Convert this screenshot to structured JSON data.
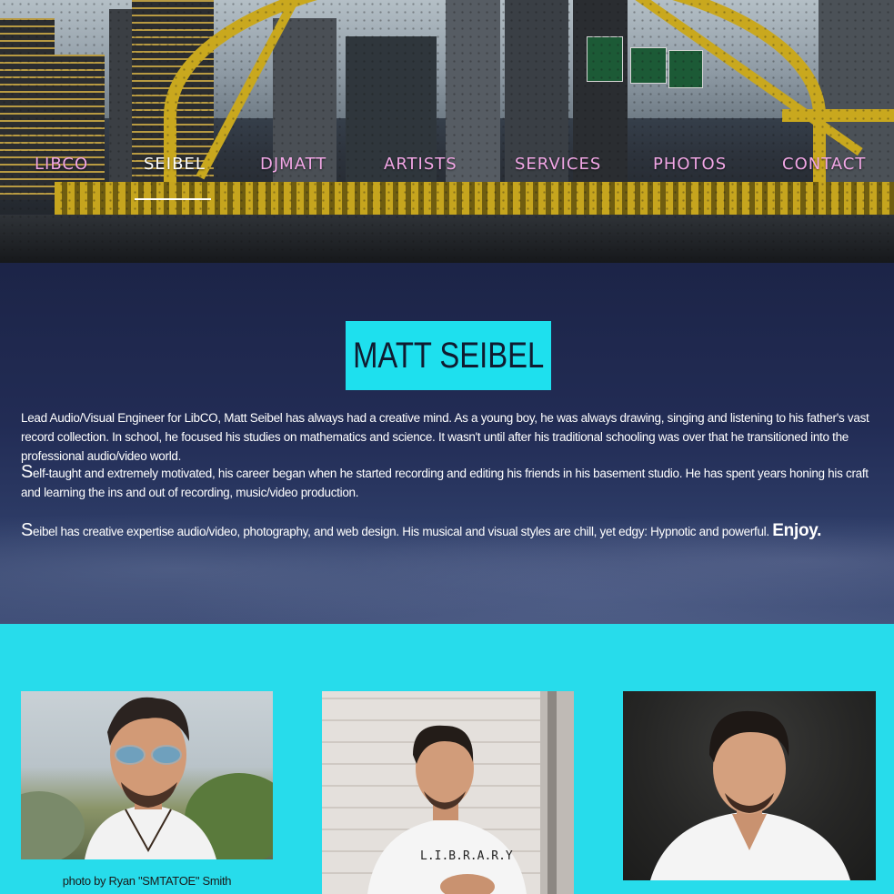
{
  "nav": {
    "items": [
      {
        "label": "LIBCO",
        "active": false
      },
      {
        "label": "SEIBEL",
        "active": true
      },
      {
        "label": "DJMATT",
        "active": false
      },
      {
        "label": "ARTISTS",
        "active": false
      },
      {
        "label": "SERVICES",
        "active": false
      },
      {
        "label": "PHOTOS",
        "active": false
      },
      {
        "label": "CONTACT",
        "active": false
      }
    ]
  },
  "about": {
    "title": "MATT SEIBEL",
    "paragraph1": "Lead Audio/Visual Engineer for LibCO, Matt Seibel has always had a creative mind. As a young boy, he was always drawing, singing and listening to his father's vast record collection.  In school, he focused his studies on mathematics and science. It wasn't until after his traditional schooling was over that he transitioned into the professional audio/video world.",
    "paragraph2_drop": "S",
    "paragraph2": "elf-taught and extremely motivated, his career began when he started recording and editing his friends in his basement studio.  He has spent years honing his craft and learning the ins and out of recording, music/video production.",
    "paragraph3_drop": "S",
    "paragraph3": "eibel has creative expertise audio/video, photography, and web design. His musical and visual styles are chill, yet edgy: Hypnotic and powerful. ",
    "paragraph3_enjoy": "Enjoy."
  },
  "gallery": {
    "caption": "photo by Ryan \"SMTATOE\" Smith"
  },
  "colors": {
    "accent": "#1ee0ee",
    "nav_text": "#f2a7e6",
    "nav_active": "#ffffff",
    "about_bg": "#1c2447"
  }
}
